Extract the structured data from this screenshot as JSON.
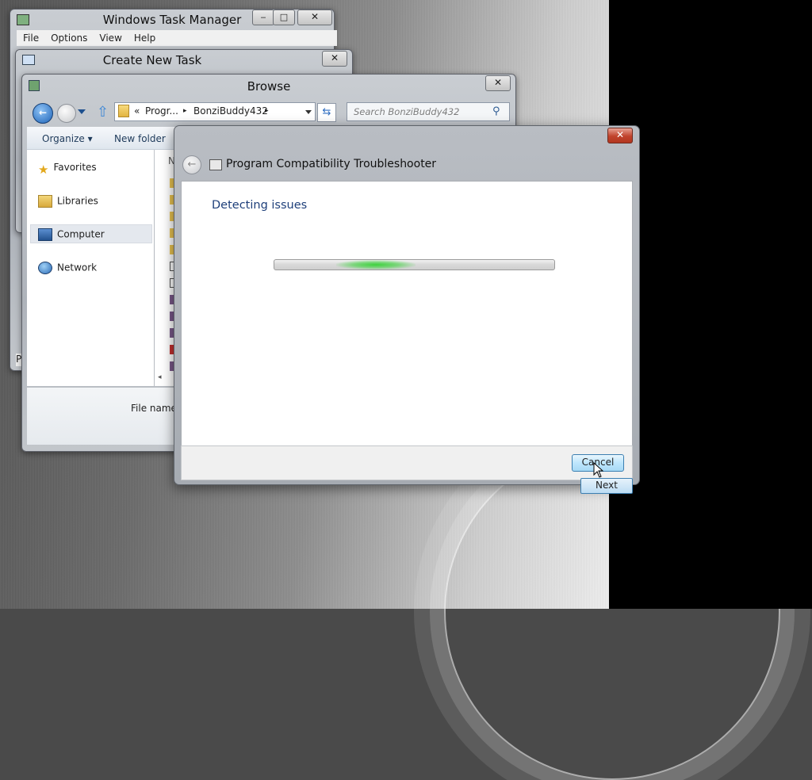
{
  "task_manager": {
    "title": "Windows Task Manager",
    "menu": [
      "File",
      "Options",
      "View",
      "Help"
    ],
    "minimize_glyph": "‒",
    "maximize_glyph": "□",
    "close_glyph": "✕",
    "partial_label": "P"
  },
  "create_task": {
    "title": "Create New Task",
    "close_glyph": "✕"
  },
  "browse": {
    "title": "Browse",
    "close_glyph": "✕",
    "address": {
      "prefix": "«",
      "segments": [
        "Progr...",
        "BonziBuddy432"
      ],
      "separator": "▸"
    },
    "search_placeholder": "Search BonziBuddy432",
    "toolbar": {
      "organize": "Organize ▾",
      "new_folder": "New folder"
    },
    "nav": {
      "favorites": "Favorites",
      "libraries": "Libraries",
      "computer": "Computer",
      "network": "Network"
    },
    "column_initial": "N",
    "file_name_label": "File name:"
  },
  "troubleshooter": {
    "close_glyph": "✕",
    "back_glyph": "←",
    "title": "Program Compatibility Troubleshooter",
    "heading": "Detecting issues",
    "cancel": "Cancel",
    "next": "Next"
  }
}
